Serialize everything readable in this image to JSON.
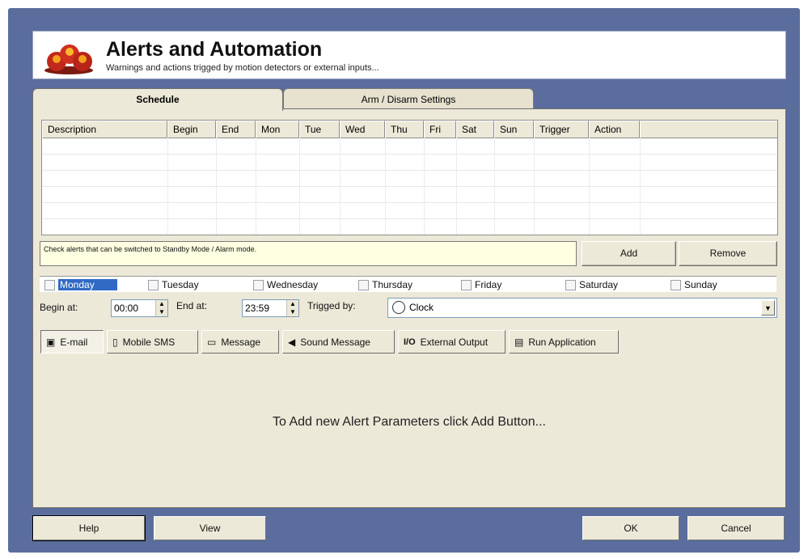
{
  "header": {
    "title": "Alerts and Automation",
    "subtitle": "Warnings and actions trigged by motion detectors or external inputs..."
  },
  "tabs": [
    {
      "label": "Schedule",
      "active": true
    },
    {
      "label": "Arm / Disarm Settings",
      "active": false
    }
  ],
  "table": {
    "columns": [
      "Description",
      "Begin",
      "End",
      "Mon",
      "Tue",
      "Wed",
      "Thu",
      "Fri",
      "Sat",
      "Sun",
      "Trigger",
      "Action"
    ],
    "rows": []
  },
  "note": "Check alerts that can be switched to Standby Mode / Alarm mode.",
  "buttons": {
    "add": "Add",
    "remove": "Remove"
  },
  "days": [
    {
      "label": "Monday",
      "checked": false,
      "selected": true
    },
    {
      "label": "Tuesday",
      "checked": false
    },
    {
      "label": "Wednesday",
      "checked": false
    },
    {
      "label": "Thursday",
      "checked": false
    },
    {
      "label": "Friday",
      "checked": false
    },
    {
      "label": "Saturday",
      "checked": false
    },
    {
      "label": "Sunday",
      "checked": false
    }
  ],
  "schedule": {
    "begin_label": "Begin at:",
    "begin_value": "00:00",
    "end_label": "End at:",
    "end_value": "23:59",
    "trigger_label": "Trigged by:",
    "trigger_value": "Clock"
  },
  "subtabs": [
    {
      "label": "E-mail",
      "icon": "email-icon",
      "active": true
    },
    {
      "label": "Mobile SMS",
      "icon": "mobile-icon"
    },
    {
      "label": "Message",
      "icon": "message-icon"
    },
    {
      "label": "Sound Message",
      "icon": "speaker-icon"
    },
    {
      "label": "External Output",
      "icon": "io-icon",
      "icon_text": "I/O"
    },
    {
      "label": "Run Application",
      "icon": "application-icon"
    }
  ],
  "hint": "To Add new Alert Parameters click Add Button...",
  "footer": {
    "help": "Help",
    "view": "View",
    "ok": "OK",
    "cancel": "Cancel"
  },
  "colors": {
    "frame": "#5a6d9c",
    "panel": "#ece9d8",
    "note": "#ffffe1",
    "selection": "#316ac5"
  }
}
